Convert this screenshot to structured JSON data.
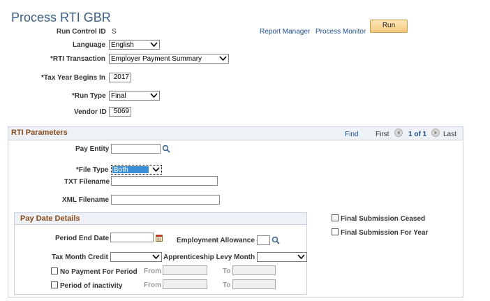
{
  "page": {
    "title": "Process RTI GBR"
  },
  "header": {
    "run_control_label": "Run Control ID",
    "run_control_value": "S",
    "report_manager": "Report Manager",
    "process_monitor": "Process Monitor",
    "run_button": "Run",
    "language_label": "Language",
    "language_value": "English",
    "rti_transaction_label": "*RTI Transaction",
    "rti_transaction_value": "Employer Payment Summary",
    "tax_year_label": "*Tax Year Begins In",
    "tax_year_value": "2017",
    "run_type_label": "*Run Type",
    "run_type_value": "Final",
    "vendor_id_label": "Vendor ID",
    "vendor_id_value": "5069"
  },
  "rti_parameters": {
    "title": "RTI Parameters",
    "find": "Find",
    "first": "First",
    "page_count": "1 of 1",
    "last": "Last",
    "pay_entity_label": "Pay Entity",
    "pay_entity_value": "",
    "file_type_label": "*File Type",
    "file_type_value": "Both",
    "txt_filename_label": "TXT Filename",
    "txt_filename_value": "",
    "xml_filename_label": "XML Filename",
    "xml_filename_value": "",
    "final_submission_ceased": "Final Submission Ceased",
    "final_submission_for_year": "Final Submission For Year"
  },
  "pay_date_details": {
    "title": "Pay Date Details",
    "period_end_date_label": "Period End Date",
    "period_end_date_value": "",
    "employment_allowance_label": "Employment Allowance",
    "employment_allowance_value": "",
    "tax_month_credit_label": "Tax Month Credit",
    "tax_month_credit_value": "",
    "apprenticeship_levy_label": "Apprenticeship Levy Month",
    "apprenticeship_levy_value": "",
    "no_payment_label": "No Payment For Period",
    "period_inactivity_label": "Period of inactivity",
    "from_label": "From",
    "to_label": "To"
  },
  "colors": {
    "title": "#3a5f86",
    "section_title": "#8a4a1a",
    "link": "#1f4e8c",
    "file_type_highlight": "#3b8fd6"
  }
}
